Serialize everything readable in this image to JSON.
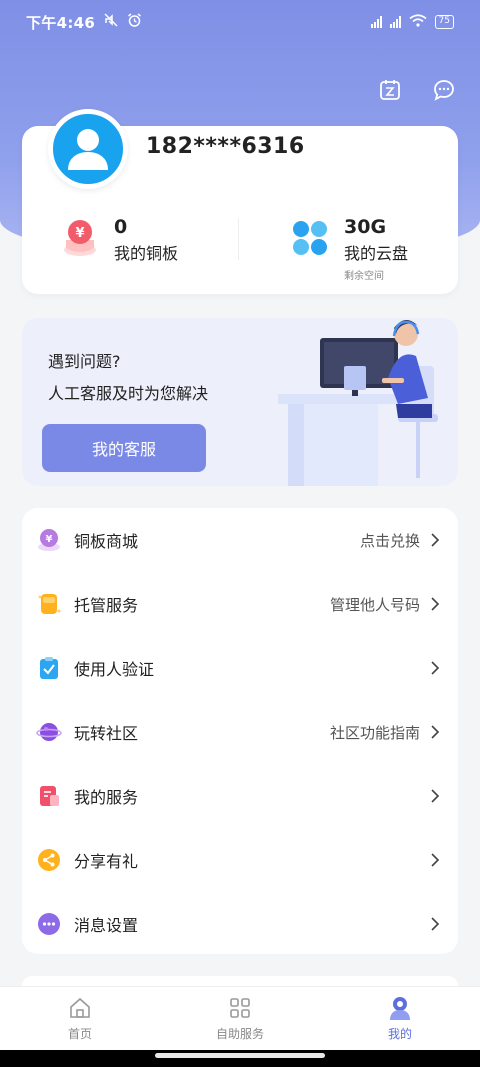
{
  "status_bar": {
    "time": "下午4:46",
    "battery": "75"
  },
  "profile": {
    "phone": "182****6316"
  },
  "stats": {
    "copper": {
      "value": "0",
      "label": "我的铜板"
    },
    "cloud": {
      "value": "30G",
      "label": "我的云盘",
      "sub": "剩余空间"
    }
  },
  "service": {
    "question": "遇到问题?",
    "answer": "人工客服及时为您解决",
    "button": "我的客服"
  },
  "menu": [
    {
      "label": "铜板商城",
      "extra": "点击兑换",
      "icon": "coin-shop-icon"
    },
    {
      "label": "托管服务",
      "extra": "管理他人号码",
      "icon": "sim-card-icon"
    },
    {
      "label": "使用人验证",
      "extra": "",
      "icon": "verify-check-icon"
    },
    {
      "label": "玩转社区",
      "extra": "社区功能指南",
      "icon": "planet-icon"
    },
    {
      "label": "我的服务",
      "extra": "",
      "icon": "service-doc-icon"
    },
    {
      "label": "分享有礼",
      "extra": "",
      "icon": "share-icon"
    },
    {
      "label": "消息设置",
      "extra": "",
      "icon": "message-icon"
    }
  ],
  "tabs": [
    {
      "label": "首页",
      "icon": "home-icon"
    },
    {
      "label": "自助服务",
      "icon": "grid-icon"
    },
    {
      "label": "我的",
      "icon": "user-icon"
    }
  ],
  "colors": {
    "accent": "#7a89e6",
    "active_tab": "#5b6fe0",
    "avatar_bg": "#19a3ee"
  }
}
